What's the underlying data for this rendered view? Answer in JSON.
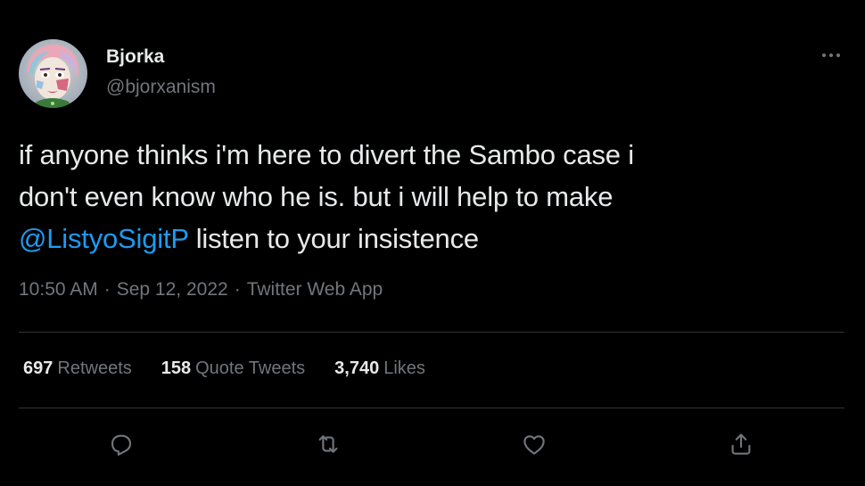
{
  "user": {
    "display_name": "Bjorka",
    "handle": "@bjorxanism",
    "avatar_icon": "avatar-image"
  },
  "tweet": {
    "line1": "if anyone thinks i'm here to divert the Sambo case i",
    "line2": "don't even know who he is. but i will help to make",
    "mention": "@ListyoSigitP",
    "line3_rest": " listen to your insistence"
  },
  "meta": {
    "time": "10:50 AM",
    "separator": "·",
    "date": "Sep 12, 2022",
    "source": "Twitter Web App"
  },
  "stats": {
    "retweets_count": "697",
    "retweets_label": "Retweets",
    "quotes_count": "158",
    "quotes_label": "Quote Tweets",
    "likes_count": "3,740",
    "likes_label": "Likes"
  },
  "actions": [
    {
      "icon": "reply-icon"
    },
    {
      "icon": "retweet-icon"
    },
    {
      "icon": "like-icon"
    },
    {
      "icon": "share-icon"
    }
  ],
  "colors": {
    "background": "#000000",
    "text": "#e7e9ea",
    "secondary": "#71767b",
    "accent": "#1d9bf0",
    "divider": "#2f3336"
  }
}
